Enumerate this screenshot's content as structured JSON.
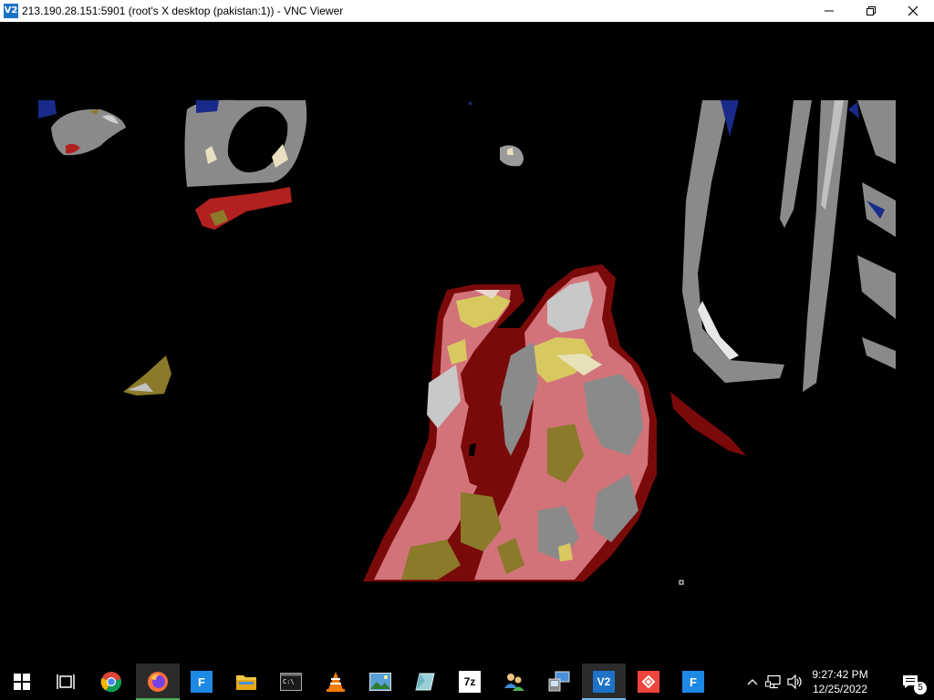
{
  "window": {
    "app_icon": "vnc-viewer-icon",
    "app_icon_text": "V2",
    "title": "213.190.28.151:5901 (root's X desktop (pakistan:1)) - VNC Viewer",
    "controls": {
      "minimize_icon": "minimize-icon",
      "restore_icon": "restore-icon",
      "close_icon": "close-icon"
    }
  },
  "remote_view": {
    "content": "camera-feed",
    "colors": {
      "background": "#000000",
      "skin_pink": "#d2737a",
      "dark_red": "#7a0a0a",
      "olive": "#8a7a2a",
      "grey": "#808080",
      "light_grey": "#b8b8b8",
      "yellow": "#d8c860"
    }
  },
  "taskbar": {
    "apps": [
      {
        "name": "start-button",
        "icon": "windows-logo-icon",
        "text": ""
      },
      {
        "name": "task-view-button",
        "icon": "task-view-icon",
        "text": ""
      },
      {
        "name": "chrome",
        "icon": "chrome-icon",
        "text": ""
      },
      {
        "name": "firefox",
        "icon": "firefox-icon",
        "text": ""
      },
      {
        "name": "app-f-1",
        "icon": "f-app-icon",
        "text": "F"
      },
      {
        "name": "file-explorer",
        "icon": "folder-icon",
        "text": ""
      },
      {
        "name": "terminal",
        "icon": "terminal-icon",
        "text": ""
      },
      {
        "name": "vlc",
        "icon": "vlc-icon",
        "text": ""
      },
      {
        "name": "image-viewer",
        "icon": "picture-icon",
        "text": ""
      },
      {
        "name": "app-crystal",
        "icon": "crystal-icon",
        "text": ""
      },
      {
        "name": "7zip",
        "icon": "7zip-icon",
        "text": "7z"
      },
      {
        "name": "network-users",
        "icon": "users-icon",
        "text": ""
      },
      {
        "name": "remote-desktop",
        "icon": "remote-desktop-icon",
        "text": ""
      },
      {
        "name": "vnc-viewer",
        "icon": "vnc-viewer-icon",
        "text": "V2"
      },
      {
        "name": "anydesk",
        "icon": "anydesk-icon",
        "text": ""
      },
      {
        "name": "app-f-2",
        "icon": "f-app-icon",
        "text": "F"
      }
    ],
    "tray": {
      "chevron_icon": "chevron-up-icon",
      "network_icon": "network-icon",
      "volume_icon": "volume-icon",
      "time": "9:27:42 PM",
      "date": "12/25/2022",
      "notification_icon": "notification-icon",
      "notification_count": "5"
    }
  }
}
